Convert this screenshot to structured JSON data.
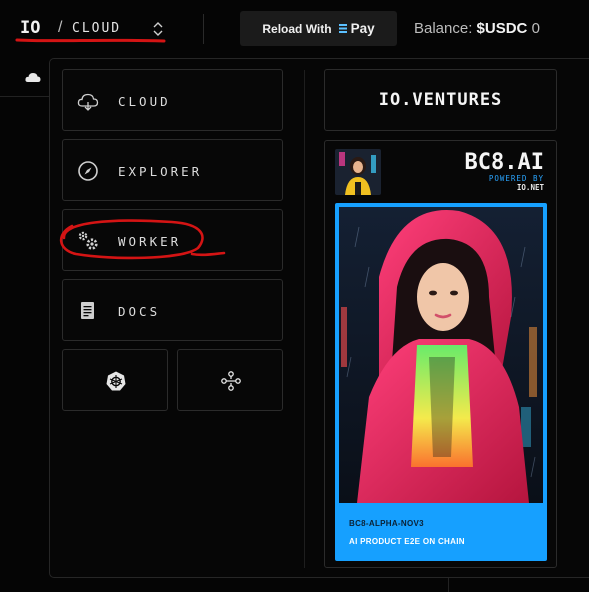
{
  "header": {
    "logo_text": "IO",
    "separator": "/",
    "breadcrumb": "CLOUD",
    "reload_label": "Reload With",
    "pay_label": "Pay",
    "balance_label": "Balance:",
    "balance_currency": "$USDC",
    "balance_value": "0"
  },
  "menu": {
    "items": [
      {
        "label": "CLOUD",
        "icon": "cloud-icon"
      },
      {
        "label": "EXPLORER",
        "icon": "compass-icon"
      },
      {
        "label": "WORKER",
        "icon": "gears-icon"
      },
      {
        "label": "DOCS",
        "icon": "document-icon"
      }
    ],
    "small_items": [
      {
        "icon": "kubernetes-icon"
      },
      {
        "icon": "network-nodes-icon"
      }
    ]
  },
  "promo": {
    "ventures_text": "IO.VENTURES",
    "bc8_title": "BC8.AI",
    "powered_by": "POWERED BY",
    "powered_brand": "IO.NET",
    "poster_code": "BC8-ALPHA-NOV3",
    "poster_tagline": "AI PRODUCT E2E ON CHAIN"
  },
  "colors": {
    "accent_blue": "#16a0ff",
    "annotation_red": "#d41414",
    "background": "#050505"
  }
}
